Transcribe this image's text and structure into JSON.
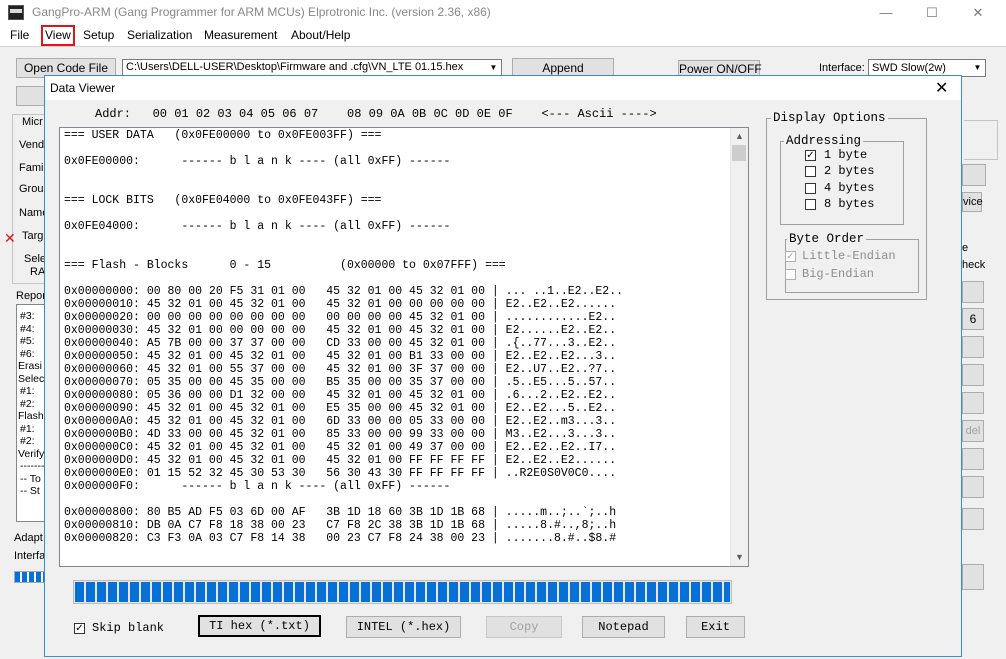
{
  "app": {
    "title": "GangPro-ARM (Gang Programmer for ARM MCUs)   Elprotronic Inc. (version 2.36, x86)",
    "logo_text": "GANG PRO",
    "controls": {
      "minimize": "—",
      "maximize": "☐",
      "close": "✕"
    }
  },
  "menu": [
    "File",
    "View",
    "Setup",
    "Serialization",
    "Measurement",
    "About/Help"
  ],
  "main": {
    "open_code_button": "Open Code File",
    "code_file_path": "C:\\Users\\DELL-USER\\Desktop\\Firmware and .cfg\\VN_LTE 01.15.hex",
    "append_button": "Append",
    "power_button": "Power ON/OFF",
    "interface_label": "Interface:",
    "interface_value": "SWD Slow(2w)",
    "left_labels": [
      "Micr",
      "Vend",
      "Famil",
      "Group",
      "Name",
      "Targ",
      "Sele",
      "RA",
      "Repor",
      "#3:",
      "#4:",
      "#5:",
      "#6:",
      "Erasi",
      "Selec",
      "#1:",
      "#2:",
      "Flash",
      "#1:",
      "#2:",
      "Verify",
      "-------",
      "-- To",
      "-- St",
      "Adapt",
      "Interfa"
    ],
    "right_labels": [
      "vice",
      "e",
      "heck",
      "6",
      "del"
    ]
  },
  "viewer": {
    "title": "Data Viewer",
    "close": "✕",
    "header": "Addr:   00 01 02 03 04 05 06 07    08 09 0A 0B 0C 0D 0E 0F    <--- Ascii ---->",
    "lines": [
      "=== USER DATA   (0x0FE00000 to 0x0FE003FF) ===",
      "",
      "0x0FE00000:      ------ b l a n k ---- (all 0xFF) ------",
      "",
      "",
      "=== LOCK BITS   (0x0FE04000 to 0x0FE043FF) ===",
      "",
      "0x0FE04000:      ------ b l a n k ---- (all 0xFF) ------",
      "",
      "",
      "=== Flash - Blocks      0 - 15          (0x00000 to 0x07FFF) ===",
      "",
      "0x00000000: 00 80 00 20 F5 31 01 00   45 32 01 00 45 32 01 00 | ... ..1..E2..E2..",
      "0x00000010: 45 32 01 00 45 32 01 00   45 32 01 00 00 00 00 00 | E2..E2..E2......",
      "0x00000020: 00 00 00 00 00 00 00 00   00 00 00 00 45 32 01 00 | ............E2..",
      "0x00000030: 45 32 01 00 00 00 00 00   45 32 01 00 45 32 01 00 | E2......E2..E2..",
      "0x00000040: A5 7B 00 00 37 37 00 00   CD 33 00 00 45 32 01 00 | .{..77...3..E2..",
      "0x00000050: 45 32 01 00 45 32 01 00   45 32 01 00 B1 33 00 00 | E2..E2..E2...3..",
      "0x00000060: 45 32 01 00 55 37 00 00   45 32 01 00 3F 37 00 00 | E2..U7..E2..?7..",
      "0x00000070: 05 35 00 00 45 35 00 00   B5 35 00 00 35 37 00 00 | .5..E5...5..57..",
      "0x00000080: 05 36 00 00 D1 32 00 00   45 32 01 00 45 32 01 00 | .6...2..E2..E2..",
      "0x00000090: 45 32 01 00 45 32 01 00   E5 35 00 00 45 32 01 00 | E2..E2...5..E2..",
      "0x000000A0: 45 32 01 00 45 32 01 00   6D 33 00 00 05 33 00 00 | E2..E2..m3...3..",
      "0x000000B0: 4D 33 00 00 45 32 01 00   85 33 00 00 99 33 00 00 | M3..E2...3...3..",
      "0x000000C0: 45 32 01 00 45 32 01 00   45 32 01 00 49 37 00 00 | E2..E2..E2..I7..",
      "0x000000D0: 45 32 01 00 45 32 01 00   45 32 01 00 FF FF FF FF | E2..E2..E2......",
      "0x000000E0: 01 15 52 32 45 30 53 30   56 30 43 30 FF FF FF FF | ..R2E0S0V0C0....",
      "0x000000F0:      ------ b l a n k ---- (all 0xFF) ------",
      "",
      "0x00000800: 80 B5 AD F5 03 6D 00 AF   3B 1D 18 60 3B 1D 1B 68 | .....m..;..`;..h",
      "0x00000810: DB 0A C7 F8 18 38 00 23   C7 F8 2C 38 3B 1D 1B 68 | .....8.#..,8;..h",
      "0x00000820: C3 F3 0A 03 C7 F8 14 38   00 23 C7 F8 24 38 00 23 | .......8.#..$8.#"
    ],
    "progress": 1.0,
    "display_options": {
      "title": "Display Options",
      "addressing": {
        "title": "Addressing",
        "options": [
          {
            "label": "1 byte",
            "checked": true
          },
          {
            "label": "2 bytes",
            "checked": false
          },
          {
            "label": "4 bytes",
            "checked": false
          },
          {
            "label": "8 bytes",
            "checked": false
          }
        ]
      },
      "byte_order": {
        "title": "Byte Order",
        "options": [
          {
            "label": "Little-Endian",
            "checked": true
          },
          {
            "label": "Big-Endian",
            "checked": false
          }
        ]
      }
    },
    "skip_blank": {
      "label": "Skip blank",
      "checked": true
    },
    "buttons": {
      "ti_hex": "TI hex (*.txt)",
      "intel": "INTEL (*.hex)",
      "copy": "Copy",
      "notepad": "Notepad",
      "exit": "Exit"
    }
  }
}
